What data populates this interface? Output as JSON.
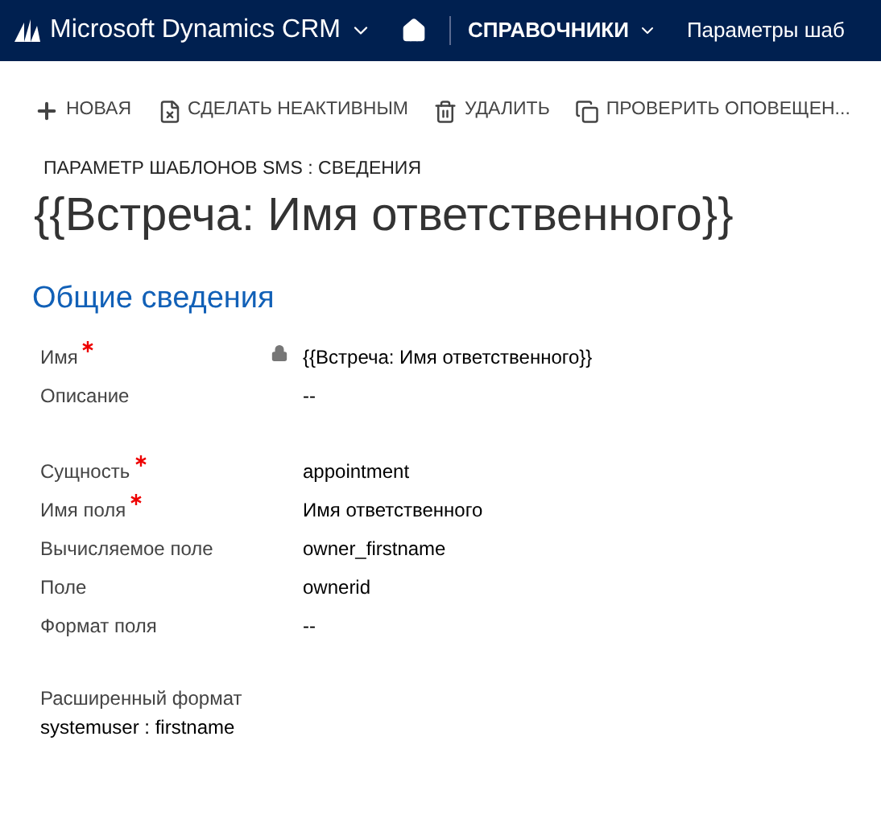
{
  "nav": {
    "app_title": "Microsoft Dynamics CRM",
    "area": "СПРАВОЧНИКИ",
    "page": "Параметры шаб"
  },
  "toolbar": [
    {
      "kind": "new",
      "label": "НОВАЯ"
    },
    {
      "kind": "deactivate",
      "label": "СДЕЛАТЬ НЕАКТИВНЫМ"
    },
    {
      "kind": "delete",
      "label": "УДАЛИТЬ"
    },
    {
      "kind": "check",
      "label": "ПРОВЕРИТЬ ОПОВЕЩЕН..."
    }
  ],
  "form": {
    "entity_caption": "ПАРАМЕТР ШАБЛОНОВ SMS : СВЕДЕНИЯ",
    "title": "{{Встреча: Имя ответственного}}",
    "section_title": "Общие сведения",
    "groups": [
      [
        {
          "label": "Имя",
          "required": true,
          "locked": true,
          "value": "{{Встреча: Имя ответственного}}"
        },
        {
          "label": "Описание",
          "required": false,
          "locked": false,
          "value": "--"
        }
      ],
      [
        {
          "label": "Сущность",
          "required": true,
          "locked": false,
          "value": "appointment"
        },
        {
          "label": "Имя поля",
          "required": true,
          "locked": false,
          "value": "Имя ответственного"
        },
        {
          "label": "Вычисляемое поле",
          "required": false,
          "locked": false,
          "value": "owner_firstname"
        },
        {
          "label": "Поле",
          "required": false,
          "locked": false,
          "value": "ownerid"
        },
        {
          "label": "Формат поля",
          "required": false,
          "locked": false,
          "value": "--"
        }
      ]
    ],
    "extended": {
      "label": "Расширенный формат",
      "value": "systemuser : firstname"
    }
  }
}
